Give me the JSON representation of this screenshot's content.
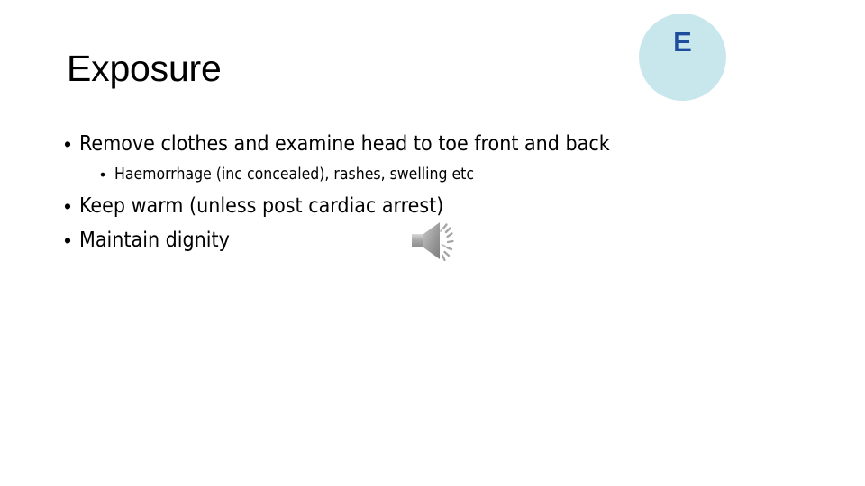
{
  "slide": {
    "background_color": "#ffffff",
    "title": "Exposure",
    "badge": {
      "letter": "E",
      "circle_color": "#c8e7ec",
      "letter_color": "#1f4d9e"
    },
    "bullets": [
      {
        "level": 1,
        "marker": "•",
        "text": "Remove clothes and examine head to toe front and back"
      },
      {
        "level": 2,
        "marker": "•",
        "text": "Haemorrhage (inc concealed), rashes, swelling etc"
      },
      {
        "level": 1,
        "marker": "•",
        "text": "Keep warm (unless post cardiac arrest)"
      },
      {
        "level": 1,
        "marker": "•",
        "text": "Maintain dignity"
      }
    ],
    "media": {
      "audio_icon_name": "speaker-audio-icon",
      "icon_color": "#9b9b9b"
    }
  }
}
